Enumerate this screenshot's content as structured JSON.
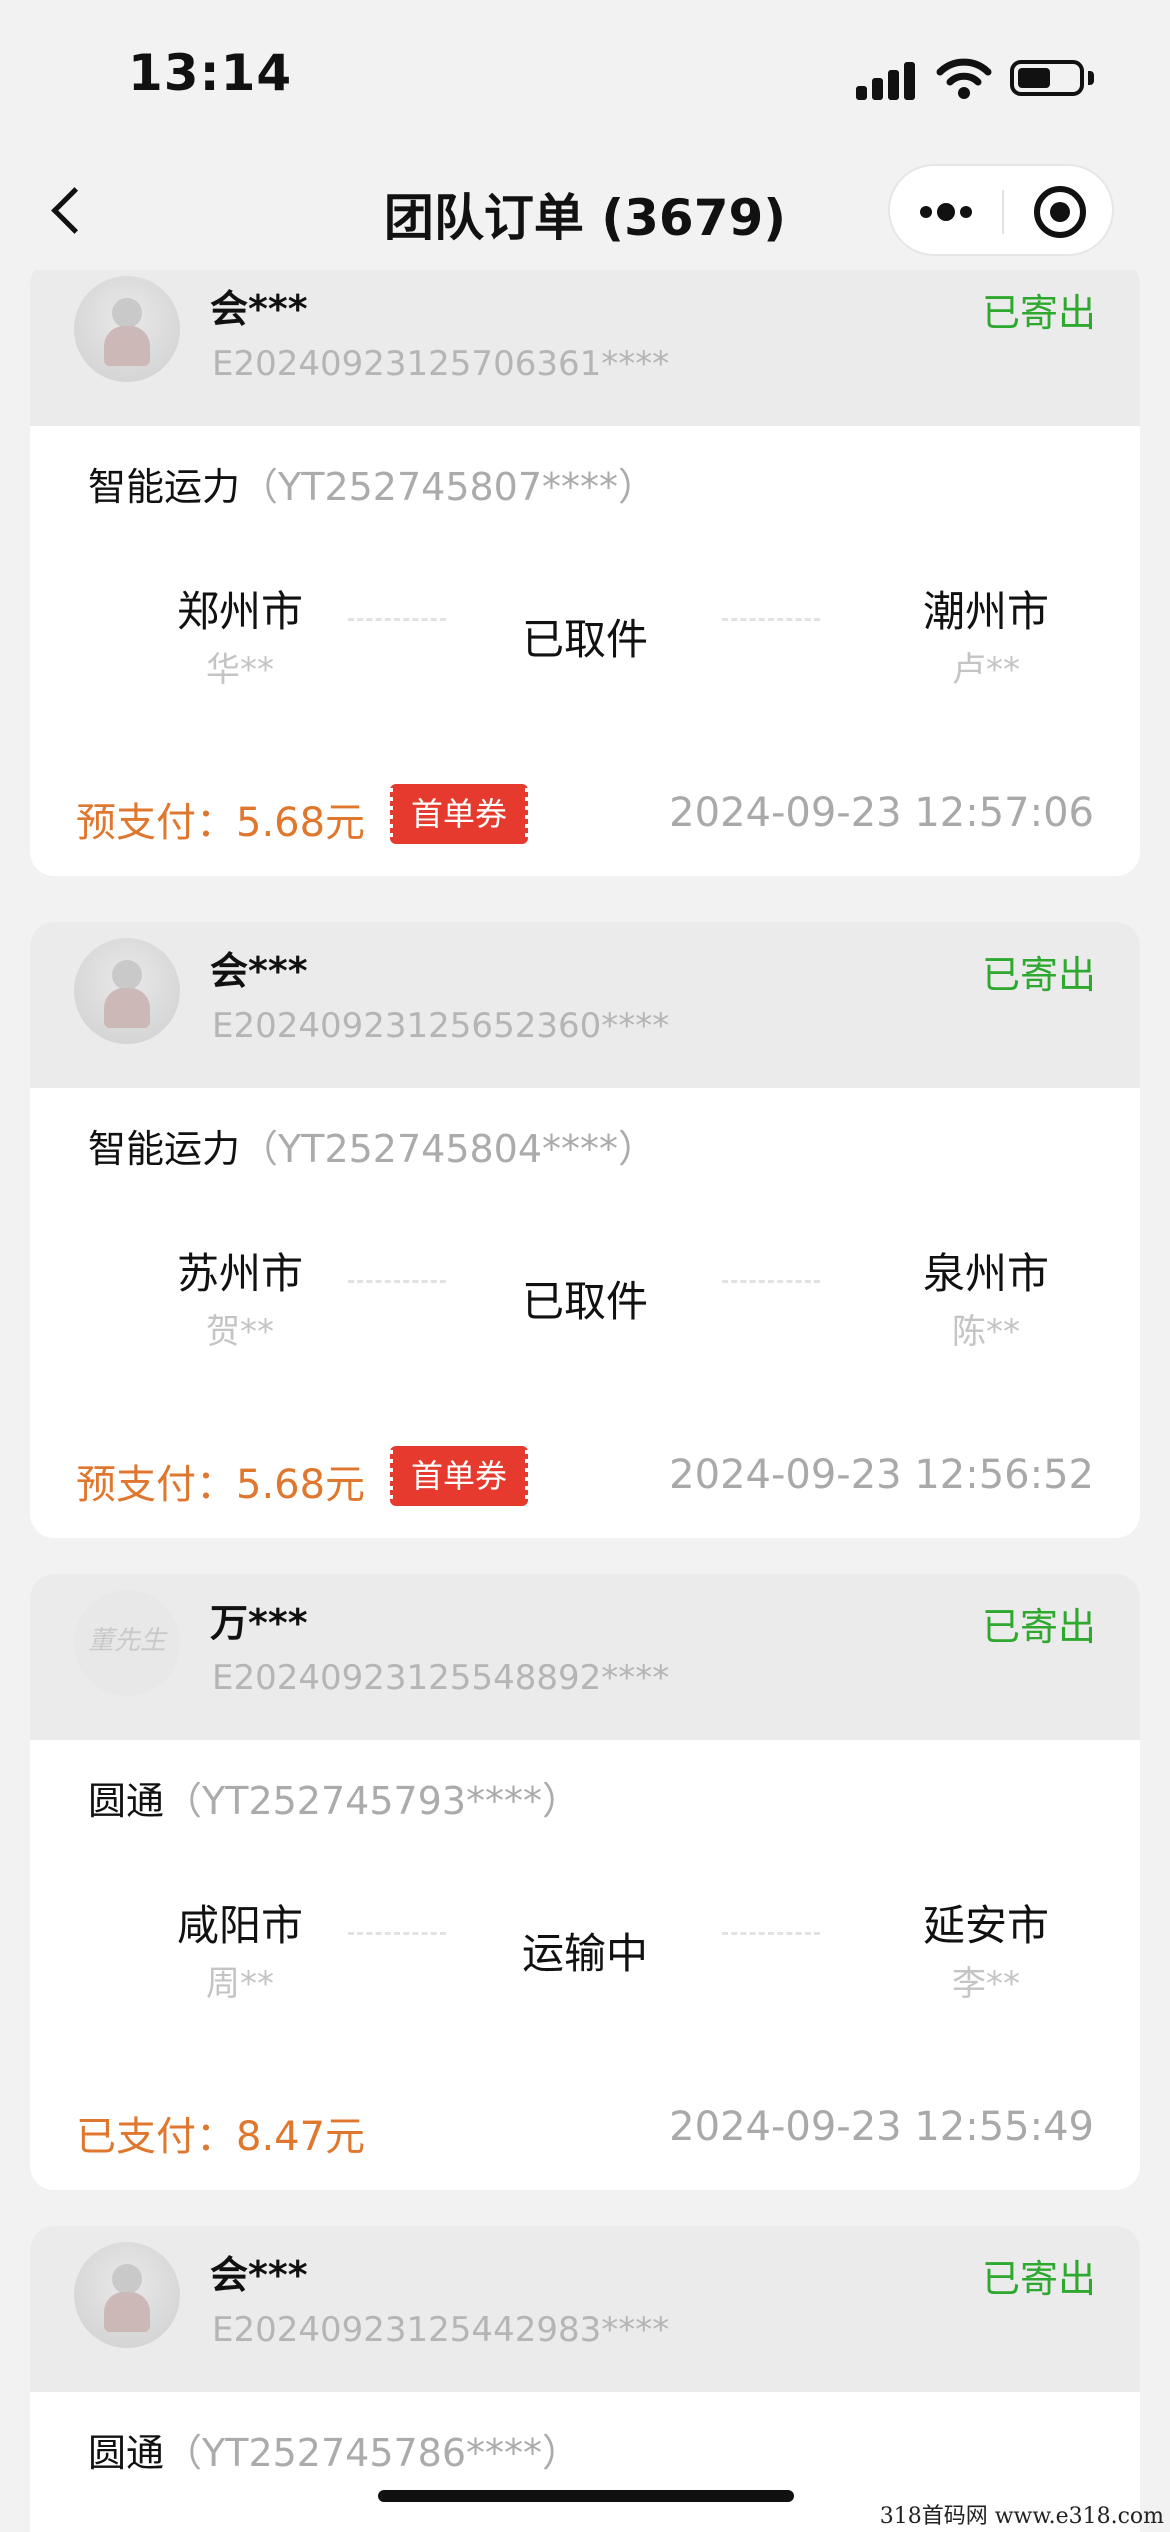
{
  "status_bar": {
    "time": "13:14",
    "battery_level": 0.55
  },
  "nav": {
    "title": "团队订单 (3679)"
  },
  "orders": [
    {
      "buyer": "会***",
      "order_no": "E20240923125706361****",
      "status": "已寄出",
      "carrier": "智能运力",
      "tracking": "（YT252745807****）",
      "from_city": "郑州市",
      "from_person": "华**",
      "to_city": "潮州市",
      "to_person": "卢**",
      "transit": "已取件",
      "price": "预支付：5.68元",
      "coupon": "首单券",
      "time": "2024-09-23 12:57:06",
      "avatar": "avatar-cartoon"
    },
    {
      "buyer": "会***",
      "order_no": "E20240923125652360****",
      "status": "已寄出",
      "carrier": "智能运力",
      "tracking": "（YT252745804****）",
      "from_city": "苏州市",
      "from_person": "贺**",
      "to_city": "泉州市",
      "to_person": "陈**",
      "transit": "已取件",
      "price": "预支付：5.68元",
      "coupon": "首单券",
      "time": "2024-09-23 12:56:52",
      "avatar": "avatar-cartoon"
    },
    {
      "buyer": "万***",
      "order_no": "E20240923125548892****",
      "status": "已寄出",
      "carrier": "圆通",
      "tracking": "（YT252745793****）",
      "from_city": "咸阳市",
      "from_person": "周**",
      "to_city": "延安市",
      "to_person": "李**",
      "transit": "运输中",
      "price": "已支付：8.47元",
      "coupon": "",
      "time": "2024-09-23 12:55:49",
      "avatar": "avatar-logo",
      "avatar_text": "董先生"
    },
    {
      "buyer": "会***",
      "order_no": "E20240923125442983****",
      "status": "已寄出",
      "carrier": "圆通",
      "tracking": "（YT252745786****）",
      "avatar": "avatar-cartoon"
    }
  ],
  "watermark": "318首码网  www.e318.com"
}
